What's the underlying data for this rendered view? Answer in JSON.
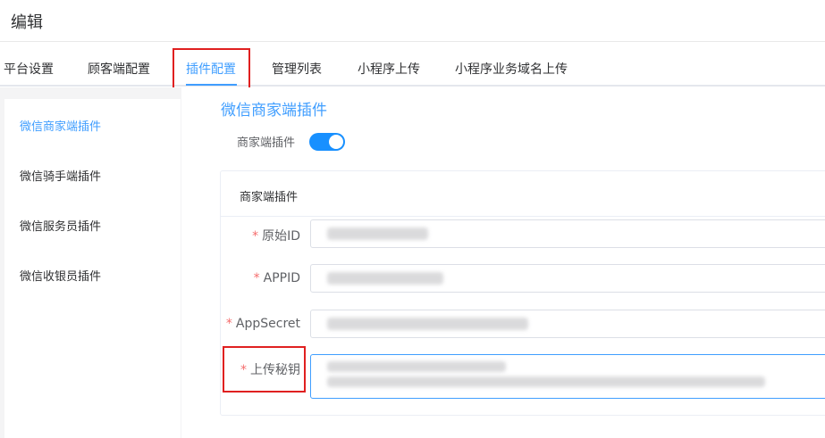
{
  "header": {
    "title": "编辑"
  },
  "tabs": [
    {
      "label": "平台设置",
      "active": false
    },
    {
      "label": "顾客端配置",
      "active": false
    },
    {
      "label": "插件配置",
      "active": true
    },
    {
      "label": "管理列表",
      "active": false
    },
    {
      "label": "小程序上传",
      "active": false
    },
    {
      "label": "小程序业务域名上传",
      "active": false
    }
  ],
  "sidebar": {
    "items": [
      {
        "label": "微信商家端插件",
        "active": true
      },
      {
        "label": "微信骑手端插件",
        "active": false
      },
      {
        "label": "微信服务员插件",
        "active": false
      },
      {
        "label": "微信收银员插件",
        "active": false
      }
    ]
  },
  "main": {
    "section_title": "微信商家端插件",
    "switch": {
      "label": "商家端插件",
      "on": true
    },
    "card": {
      "header": "商家端插件",
      "fields": [
        {
          "label": "原始ID",
          "required": true,
          "value": ""
        },
        {
          "label": "APPID",
          "required": true,
          "value": ""
        },
        {
          "label": "AppSecret",
          "required": true,
          "value": ""
        },
        {
          "label": "上传秘钥",
          "required": true,
          "value": ""
        }
      ]
    }
  },
  "colors": {
    "accent": "#409eff",
    "switch_on": "#1890ff",
    "required": "#f56c6c",
    "highlight": "#e02020"
  }
}
